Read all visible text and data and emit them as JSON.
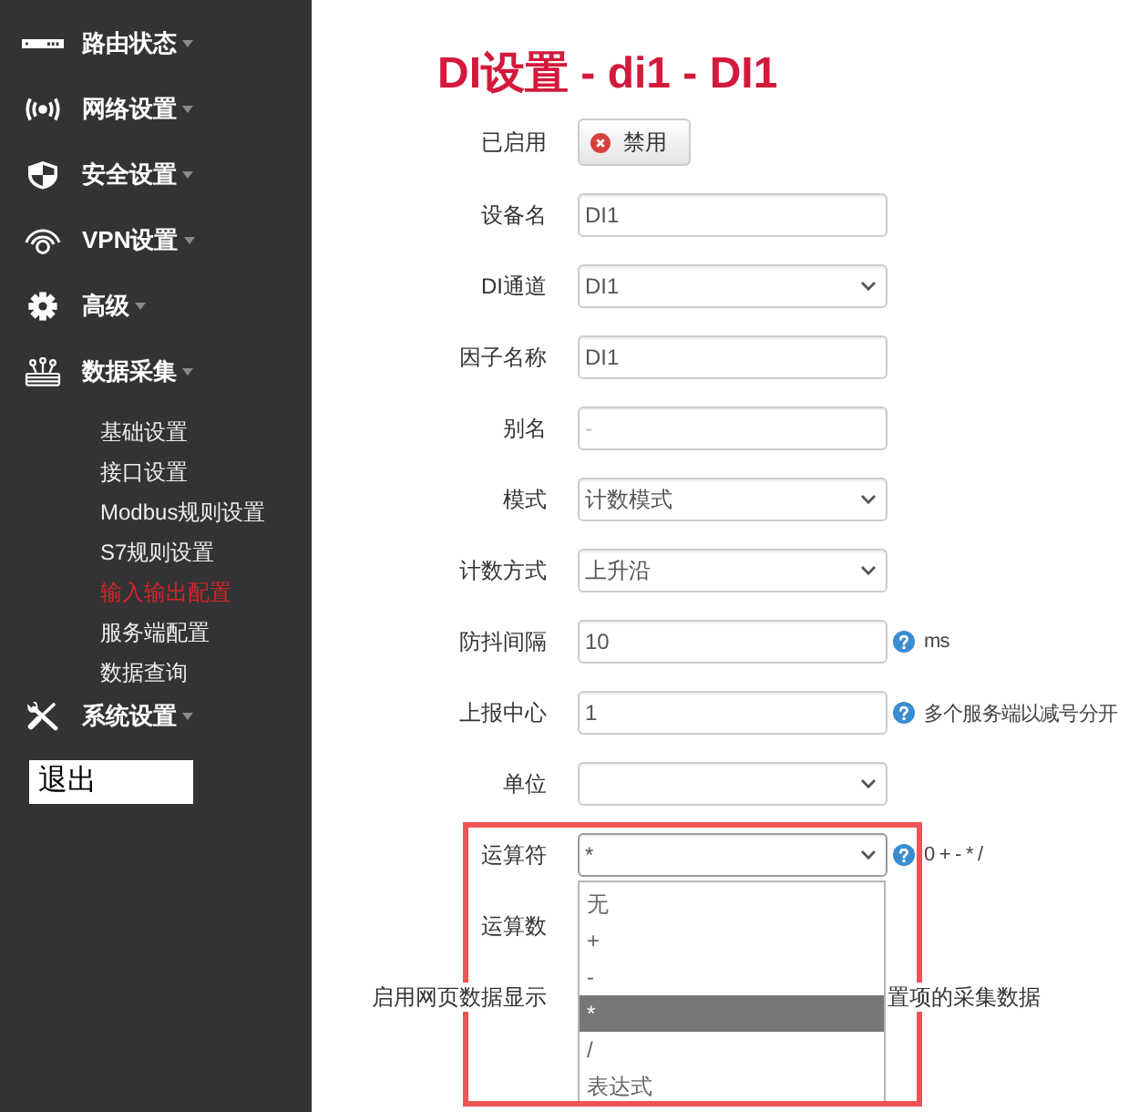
{
  "sidebar": {
    "items": [
      {
        "label": "路由状态"
      },
      {
        "label": "网络设置"
      },
      {
        "label": "安全设置"
      },
      {
        "label": "VPN设置"
      },
      {
        "label": "高级"
      },
      {
        "label": "数据采集",
        "children": [
          {
            "label": "基础设置",
            "selected": false
          },
          {
            "label": "接口设置",
            "selected": false
          },
          {
            "label": "Modbus规则设置",
            "selected": false
          },
          {
            "label": "S7规则设置",
            "selected": false
          },
          {
            "label": "输入输出配置",
            "selected": true
          },
          {
            "label": "服务端配置",
            "selected": false
          },
          {
            "label": "数据查询",
            "selected": false
          }
        ]
      },
      {
        "label": "系统设置"
      }
    ],
    "logout": "退出"
  },
  "title": "DI设置 - di1 - DI1",
  "form": {
    "fields": [
      {
        "kind": "toggle",
        "label": "已启用",
        "value": "禁用",
        "on": false
      },
      {
        "kind": "text",
        "label": "设备名",
        "value": "DI1"
      },
      {
        "kind": "select",
        "label": "DI通道",
        "value": "DI1",
        "expanded": false
      },
      {
        "kind": "text",
        "label": "因子名称",
        "value": "DI1"
      },
      {
        "kind": "text",
        "label": "别名",
        "placeholder": "-"
      },
      {
        "kind": "select",
        "label": "模式",
        "value": "计数模式",
        "expanded": false
      },
      {
        "kind": "select",
        "label": "计数方式",
        "value": "上升沿",
        "expanded": false
      },
      {
        "kind": "text",
        "label": "防抖间隔",
        "value": "10",
        "help": "ms"
      },
      {
        "kind": "text",
        "label": "上报中心",
        "value": "1",
        "help": "多个服务端以减号分开"
      },
      {
        "kind": "select",
        "label": "单位",
        "expanded": false
      },
      {
        "kind": "select",
        "label": "运算符",
        "value": "*",
        "help": "0 + - * /",
        "expanded": true,
        "highlighted": true,
        "options": [
          {
            "label": "无",
            "selected": false
          },
          {
            "label": "+",
            "selected": false
          },
          {
            "label": "-",
            "selected": false
          },
          {
            "label": "*",
            "selected": true
          },
          {
            "label": "/",
            "selected": false
          },
          {
            "label": "表达式",
            "selected": false
          }
        ]
      },
      {
        "kind": "covered",
        "label": "运算数"
      },
      {
        "kind": "covered",
        "label": "启用网页数据显示",
        "note": "置项的采集数据"
      }
    ]
  }
}
